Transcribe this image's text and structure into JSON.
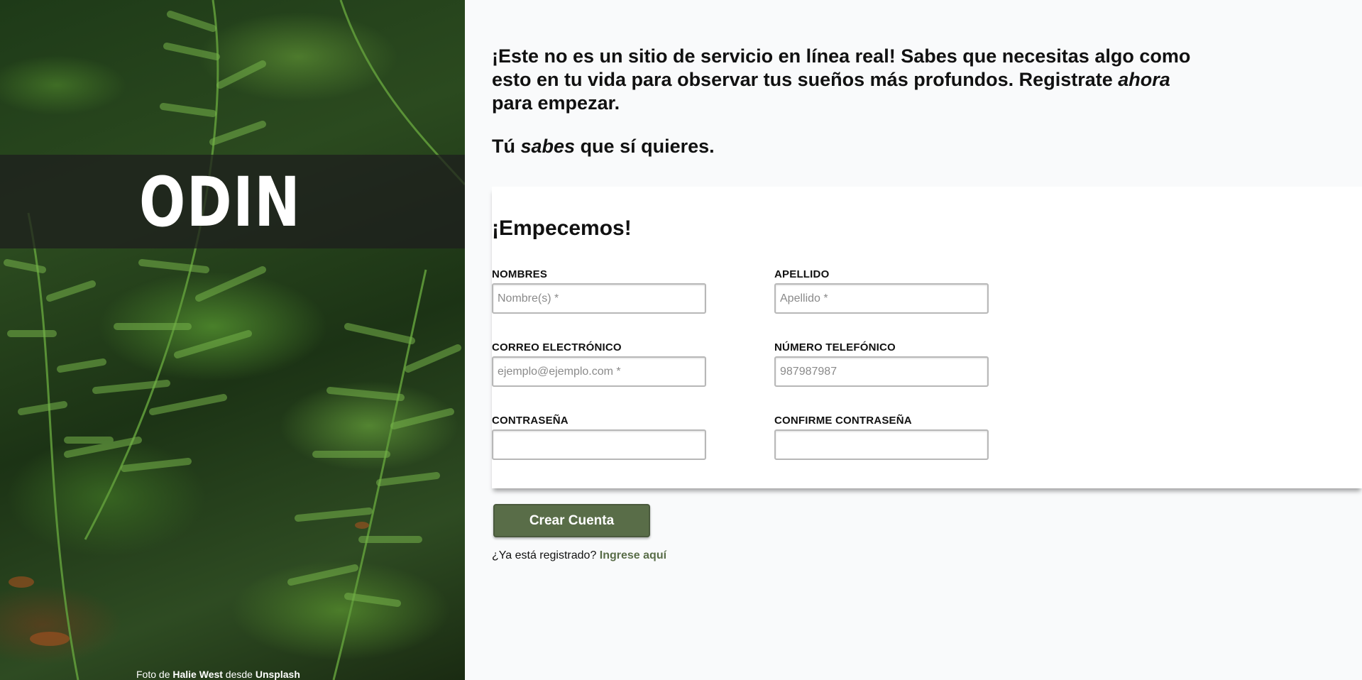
{
  "intro": {
    "line_part1": "¡Este no es un sitio de servicio en línea real! Sabes que necesitas algo como esto en tu vida para observar tus sueños más profundos. Registrate ",
    "line_em": "ahora",
    "line_part2": " para empezar.",
    "second_part1": "Tú ",
    "second_em": "sabes",
    "second_part2": " que sí quieres."
  },
  "logo": {
    "text": "ODIN",
    "icon": "odin-viking-head-icon"
  },
  "credit": {
    "prefix": "Foto de ",
    "author": "Halie West",
    "middle": " desde ",
    "source": "Unsplash"
  },
  "form": {
    "title": "¡Empecemos!",
    "fields": [
      {
        "label": "NOMBRES",
        "placeholder": "Nombre(s) *",
        "value": ""
      },
      {
        "label": "APELLIDO",
        "placeholder": "Apellido *",
        "value": ""
      },
      {
        "label": "CORREO ELECTRÓNICO",
        "placeholder": "ejemplo@ejemplo.com *",
        "value": ""
      },
      {
        "label": "NÚMERO TELEFÓNICO",
        "placeholder": "987987987",
        "value": ""
      },
      {
        "label": "CONTRASEÑA",
        "placeholder": "",
        "value": ""
      },
      {
        "label": "CONFIRME CONTRASEÑA",
        "placeholder": "",
        "value": ""
      }
    ],
    "submit_label": "Crear Cuenta"
  },
  "login": {
    "prompt": "¿Ya está registrado? ",
    "link_label": "Ingrese aquí"
  },
  "colors": {
    "accent": "#596d48",
    "background": "#f9fafb",
    "card": "#ffffff"
  }
}
